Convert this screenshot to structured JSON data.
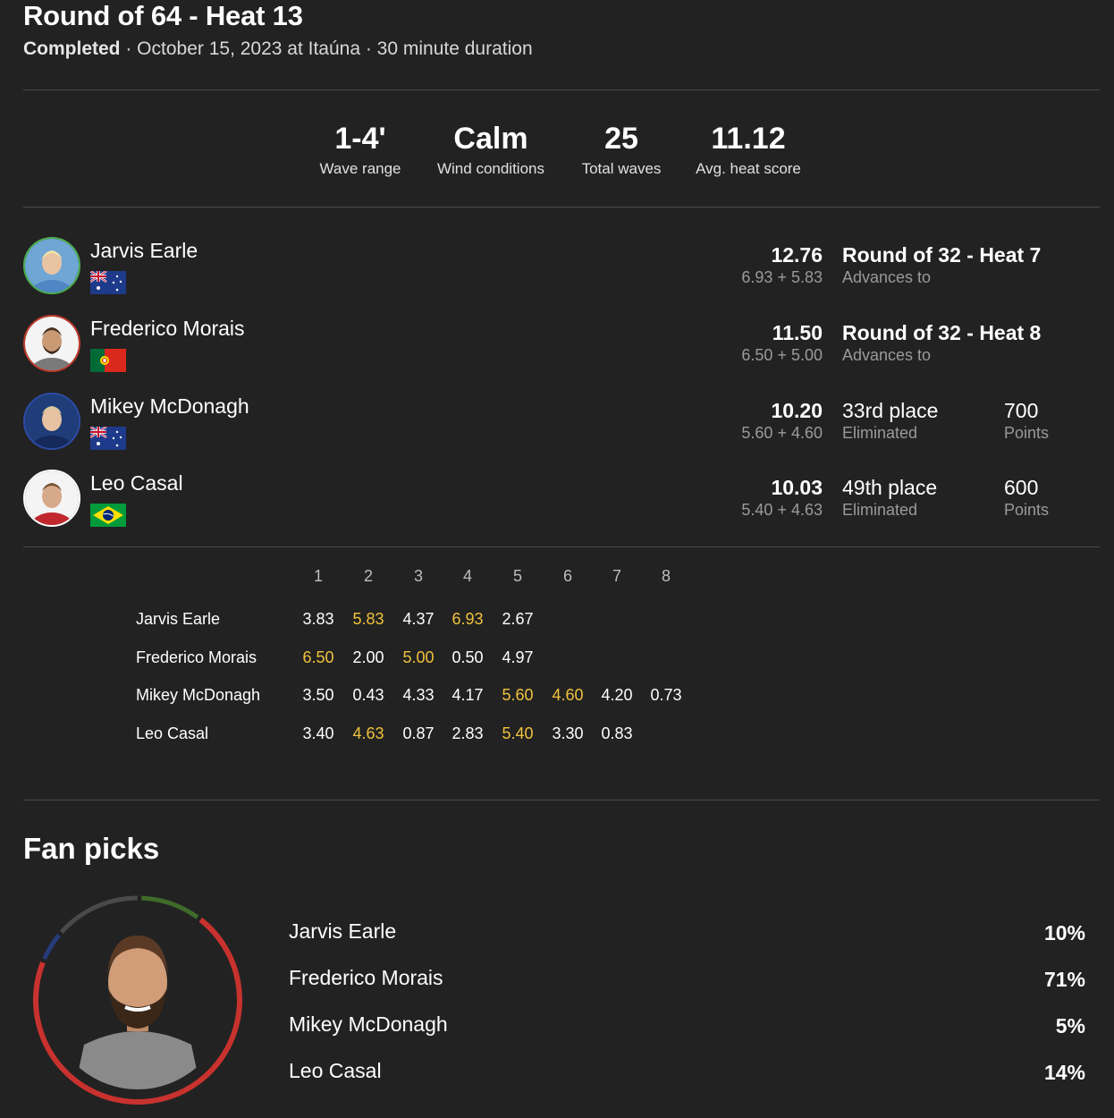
{
  "header": {
    "title": "Round of 64 - Heat 13",
    "status": "Completed",
    "details": " · October 15, 2023 at Itaúna · 30 minute duration"
  },
  "stats": [
    {
      "value": "1-4'",
      "label": "Wave range"
    },
    {
      "value": "Calm",
      "label": "Wind conditions"
    },
    {
      "value": "25",
      "label": "Total waves"
    },
    {
      "value": "11.12",
      "label": "Avg. heat score"
    }
  ],
  "competitors": [
    {
      "name": "Jarvis Earle",
      "country_flag": "australia-flag",
      "ring_color": "#4caf50",
      "score": "12.76",
      "waves": "6.93 + 5.83",
      "result": "Round of 32 - Heat 7",
      "result_sub": "Advances to",
      "points": "",
      "points_label": ""
    },
    {
      "name": "Frederico Morais",
      "country_flag": "portugal-flag",
      "ring_color": "#c0392b",
      "score": "11.50",
      "waves": "6.50 + 5.00",
      "result": "Round of 32 - Heat 8",
      "result_sub": "Advances to",
      "points": "",
      "points_label": ""
    },
    {
      "name": "Mikey McDonagh",
      "country_flag": "australia-flag",
      "ring_color": "#2c4ba8",
      "score": "10.20",
      "waves": "5.60 + 4.60",
      "result": "33rd place",
      "result_sub": "Eliminated",
      "points": "700",
      "points_label": "Points"
    },
    {
      "name": "Leo Casal",
      "country_flag": "brazil-flag",
      "ring_color": "#ffffff",
      "score": "10.03",
      "waves": "5.40 + 4.63",
      "result": "49th place",
      "result_sub": "Eliminated",
      "points": "600",
      "points_label": "Points"
    }
  ],
  "wave_table": {
    "columns": [
      "1",
      "2",
      "3",
      "4",
      "5",
      "6",
      "7",
      "8"
    ],
    "rows": [
      {
        "name": "Jarvis Earle",
        "scores": [
          "3.83",
          "5.83",
          "4.37",
          "6.93",
          "2.67"
        ],
        "counted": [
          1,
          3
        ]
      },
      {
        "name": "Frederico Morais",
        "scores": [
          "6.50",
          "2.00",
          "5.00",
          "0.50",
          "4.97"
        ],
        "counted": [
          0,
          2
        ]
      },
      {
        "name": "Mikey McDonagh",
        "scores": [
          "3.50",
          "0.43",
          "4.33",
          "4.17",
          "5.60",
          "4.60",
          "4.20",
          "0.73"
        ],
        "counted": [
          4,
          5
        ]
      },
      {
        "name": "Leo Casal",
        "scores": [
          "3.40",
          "4.63",
          "0.87",
          "2.83",
          "5.40",
          "3.30",
          "0.83"
        ],
        "counted": [
          1,
          4
        ]
      }
    ],
    "highlight_color": "#f0c23c"
  },
  "fan_picks": {
    "title": "Fan picks",
    "picks": [
      {
        "name": "Jarvis Earle",
        "percent": "10%",
        "share": 0.1,
        "color": "#3f6b2a"
      },
      {
        "name": "Frederico Morais",
        "percent": "71%",
        "share": 0.71,
        "color": "#c8322e"
      },
      {
        "name": "Mikey McDonagh",
        "percent": "5%",
        "share": 0.05,
        "color": "#263b78"
      },
      {
        "name": "Leo Casal",
        "percent": "14%",
        "share": 0.14,
        "color": "#4a4a4a"
      }
    ]
  }
}
